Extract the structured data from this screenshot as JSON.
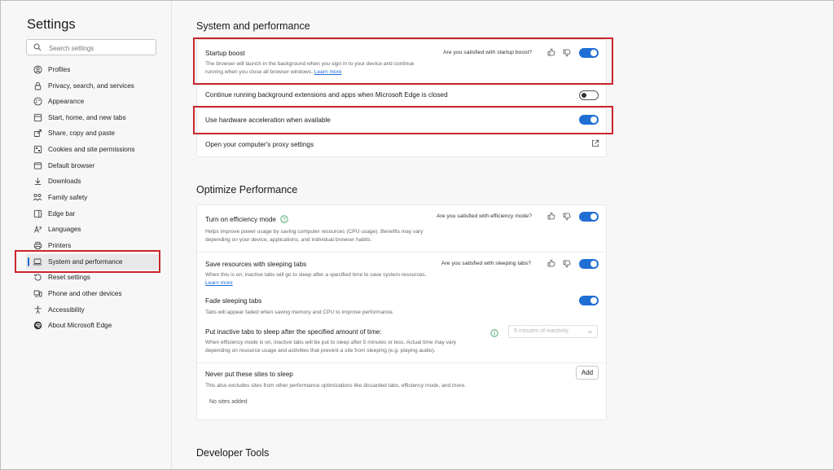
{
  "sidebar": {
    "title": "Settings",
    "search_placeholder": "Search settings",
    "items": [
      {
        "label": "Profiles",
        "icon": "profile-icon"
      },
      {
        "label": "Privacy, search, and services",
        "icon": "lock-icon"
      },
      {
        "label": "Appearance",
        "icon": "appearance-icon"
      },
      {
        "label": "Start, home, and new tabs",
        "icon": "home-icon"
      },
      {
        "label": "Share, copy and paste",
        "icon": "share-icon"
      },
      {
        "label": "Cookies and site permissions",
        "icon": "cookies-icon"
      },
      {
        "label": "Default browser",
        "icon": "browser-icon"
      },
      {
        "label": "Downloads",
        "icon": "download-icon"
      },
      {
        "label": "Family safety",
        "icon": "family-icon"
      },
      {
        "label": "Edge bar",
        "icon": "edge-bar-icon"
      },
      {
        "label": "Languages",
        "icon": "languages-icon"
      },
      {
        "label": "Printers",
        "icon": "printer-icon"
      },
      {
        "label": "System and performance",
        "icon": "laptop-icon"
      },
      {
        "label": "Reset settings",
        "icon": "reset-icon"
      },
      {
        "label": "Phone and other devices",
        "icon": "phone-icon"
      },
      {
        "label": "Accessibility",
        "icon": "accessibility-icon"
      },
      {
        "label": "About Microsoft Edge",
        "icon": "edge-logo-icon"
      }
    ],
    "active_item": "System and performance"
  },
  "system": {
    "title": "System and performance",
    "startup_boost": {
      "title": "Startup boost",
      "desc": "The browser will launch in the background when you sign in to your device and continue running when you close all browser windows.",
      "learn_more": "Learn more",
      "feedback": "Are you satisfied with startup boost?",
      "enabled": true
    },
    "background": {
      "title": "Continue running background extensions and apps when Microsoft Edge is closed",
      "enabled": false
    },
    "hardware": {
      "title": "Use hardware acceleration when available",
      "enabled": true
    },
    "proxy": {
      "title": "Open your computer's proxy settings"
    }
  },
  "optimize": {
    "title": "Optimize Performance",
    "efficiency": {
      "title": "Turn on efficiency mode",
      "desc": "Helps improve power usage by saving computer resources (CPU usage). Benefits may vary depending on your device, applications, and individual browser habits.",
      "feedback": "Are you satisfied with efficiency mode?",
      "enabled": true
    },
    "sleeping": {
      "title": "Save resources with sleeping tabs",
      "desc": "When this is on, inactive tabs will go to sleep after a specified time to save system resources.",
      "learn_more": "Learn more",
      "feedback": "Are you satisfied with sleeping tabs?",
      "enabled": true
    },
    "fade": {
      "title": "Fade sleeping tabs",
      "desc": "Tabs will appear faded when saving memory and CPU to improve performance.",
      "enabled": true
    },
    "inactive": {
      "title": "Put inactive tabs to sleep after the specified amount of time:",
      "desc": "When efficiency mode is on, inactive tabs will be put to sleep after 5 minutes or less. Actual time may vary depending on resource usage and activities that prevent a site from sleeping (e.g. playing audio).",
      "select_value": "5 minutes of inactivity"
    },
    "never": {
      "title": "Never put these sites to sleep",
      "desc": "This also excludes sites from other performance optimizations like discarded tabs, efficiency mode, and more.",
      "add_label": "Add",
      "empty_text": "No sites added"
    }
  },
  "developer": {
    "title": "Developer Tools"
  },
  "colors": {
    "accent": "#1f6ed4",
    "highlight_border": "#c8262b"
  }
}
